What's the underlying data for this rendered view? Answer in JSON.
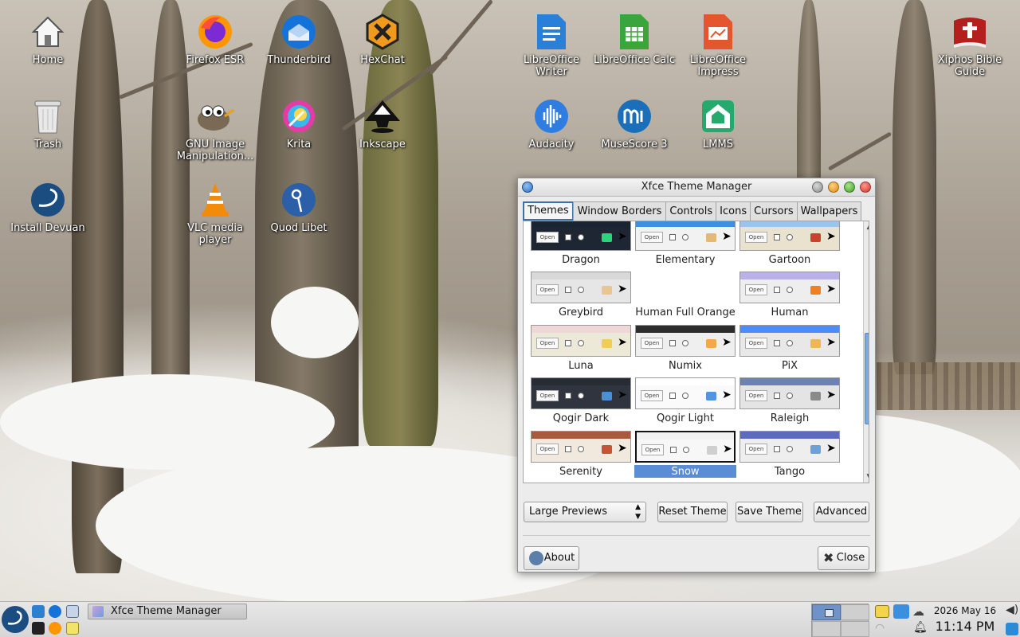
{
  "desktop": {
    "icons": [
      {
        "id": "home",
        "label": "Home"
      },
      {
        "id": "firefox",
        "label": "Firefox ESR"
      },
      {
        "id": "thunderbird",
        "label": "Thunderbird"
      },
      {
        "id": "hexchat",
        "label": "HexChat"
      },
      {
        "id": "lo-writer",
        "label": "LibreOffice Writer"
      },
      {
        "id": "lo-calc",
        "label": "LibreOffice Calc"
      },
      {
        "id": "lo-impress",
        "label": "LibreOffice Impress"
      },
      {
        "id": "xiphos",
        "label": "Xiphos Bible Guide"
      },
      {
        "id": "trash",
        "label": "Trash"
      },
      {
        "id": "gimp",
        "label": "GNU Image Manipulation..."
      },
      {
        "id": "krita",
        "label": "Krita"
      },
      {
        "id": "inkscape",
        "label": "Inkscape"
      },
      {
        "id": "audacity",
        "label": "Audacity"
      },
      {
        "id": "musescore",
        "label": "MuseScore 3"
      },
      {
        "id": "lmms",
        "label": "LMMS"
      },
      {
        "id": "install-devuan",
        "label": "Install Devuan"
      },
      {
        "id": "vlc",
        "label": "VLC media player"
      },
      {
        "id": "quodlibet",
        "label": "Quod Libet"
      }
    ]
  },
  "window": {
    "title": "Xfce Theme Manager",
    "tabs": [
      "Themes",
      "Window Borders",
      "Controls",
      "Icons",
      "Cursors",
      "Wallpapers"
    ],
    "active_tab": "Themes",
    "themes": [
      {
        "name": "Dragon",
        "bar": "#1b2431",
        "bg": "#1e2633",
        "fold": "#2bd47a"
      },
      {
        "name": "Elementary",
        "bar": "#3d8fe0",
        "bg": "#f2f2f2",
        "fold": "#e6b877"
      },
      {
        "name": "Gartoon",
        "bar": "#9cc3ec",
        "bg": "#e9e2cf",
        "fold": "#c9422d"
      },
      {
        "name": "Greybird",
        "bar": "#d8d8d8",
        "bg": "#e6e6e6",
        "fold": "#e9c58f"
      },
      {
        "name": "Human Full Orange",
        "bar": "#ffffff",
        "bg": "#ffffff",
        "fold": "#ffffff"
      },
      {
        "name": "Human",
        "bar": "#b9b1e8",
        "bg": "#efeeee",
        "fold": "#ef7f22"
      },
      {
        "name": "Luna",
        "bar": "#f0d7d7",
        "bg": "#ece9d8",
        "fold": "#f2cd53"
      },
      {
        "name": "Numix",
        "bar": "#2d2d2d",
        "bg": "#efefef",
        "fold": "#f3a84a"
      },
      {
        "name": "PiX",
        "bar": "#4d8cf5",
        "bg": "#e8e8e8",
        "fold": "#f0b557"
      },
      {
        "name": "Qogir Dark",
        "bar": "#272b33",
        "bg": "#2f343f",
        "fold": "#4a90d9"
      },
      {
        "name": "Qogir Light",
        "bar": "#ffffff",
        "bg": "#fafafa",
        "fold": "#5294e2"
      },
      {
        "name": "Raleigh",
        "bar": "#6d81b8",
        "bg": "#e4e4e4",
        "fold": "#8a8a8a"
      },
      {
        "name": "Serenity",
        "bar": "#a95a3c",
        "bg": "#f1e9dd",
        "fold": "#c75432"
      },
      {
        "name": "Snow",
        "bar": "#f0f0f0",
        "bg": "#f7f7f7",
        "fold": "#cfcfcf"
      },
      {
        "name": "Tango",
        "bar": "#5c6bc0",
        "bg": "#eeeeee",
        "fold": "#6ea2d6"
      }
    ],
    "selected_theme": "Snow",
    "open_label": "Open",
    "preview_select": "Large Previews",
    "reset_label": "Reset Theme",
    "save_label": "Save Theme",
    "advanced_label": "Advanced",
    "about_label": "About",
    "close_label": "Close"
  },
  "taskbar": {
    "task_label": "Xfce Theme Manager",
    "date": "2026 May 16",
    "time": "11:14 PM"
  }
}
